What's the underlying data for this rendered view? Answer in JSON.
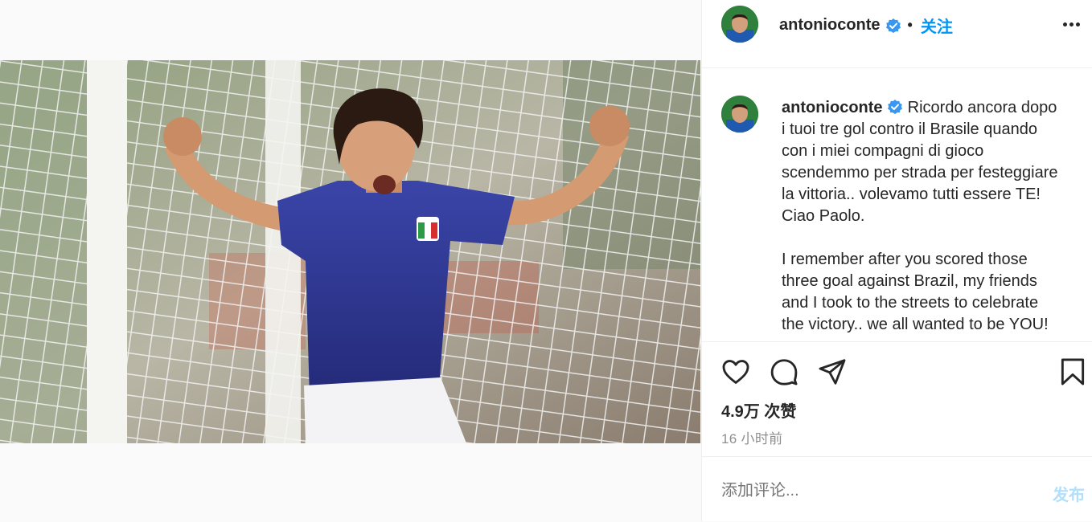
{
  "post": {
    "username": "antonioconte",
    "separator": "•",
    "follow_label": "关注",
    "more_icon": "more-options-icon",
    "caption_lines_1": [
      "Ricordo ancora dopo",
      "i tuoi tre gol contro il Brasile quando",
      "con i miei compagni di gioco",
      "scendemmo per strada per festeggiare",
      "la vittoria.. volevamo tutti essere TE!",
      "Ciao Paolo."
    ],
    "caption_lines_2": [
      "I remember after you scored those",
      "three goal against Brazil, my friends",
      "and I took to the streets to celebrate",
      "the victory.. we all wanted to be YOU!"
    ],
    "likes": "4.9万 次赞",
    "time_ago": "16 小时前",
    "comment_placeholder": "添加评论...",
    "post_label": "发布"
  },
  "icons": [
    "heart-icon",
    "comment-icon",
    "share-icon",
    "bookmark-icon",
    "verified-badge-icon"
  ],
  "colors": {
    "accent": "#0095f6",
    "post_disabled": "#b2dffc",
    "verified": "#3897f0",
    "muted": "#8e8e8e"
  }
}
